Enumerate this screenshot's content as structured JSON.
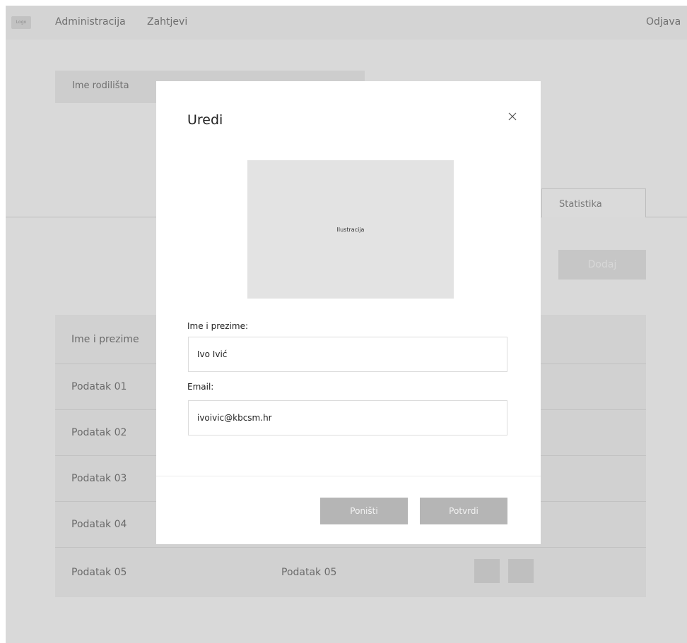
{
  "topbar": {
    "logo": "Logo",
    "nav": [
      "Administracija",
      "Zahtjevi"
    ],
    "logout": "Odjava"
  },
  "hospital": {
    "name": "Ime rodilišta"
  },
  "tabs": {
    "stats": "Statistika"
  },
  "toolbar": {
    "add_label": "Dodaj"
  },
  "table": {
    "header": "Ime i prezime",
    "rows": [
      {
        "c1": "Podatak 01",
        "c2": ""
      },
      {
        "c1": "Podatak 02",
        "c2": ""
      },
      {
        "c1": "Podatak 03",
        "c2": ""
      },
      {
        "c1": "Podatak 04",
        "c2": ""
      },
      {
        "c1": "Podatak 05",
        "c2": "Podatak 05"
      }
    ]
  },
  "modal": {
    "title": "Uredi",
    "illustration_label": "Ilustracija",
    "name_label": "Ime i prezime:",
    "name_value": "Ivo Ivić",
    "email_label": "Email:",
    "email_value": "ivoivic@kbcsm.hr",
    "cancel_label": "Poništi",
    "confirm_label": "Potvrdi"
  }
}
